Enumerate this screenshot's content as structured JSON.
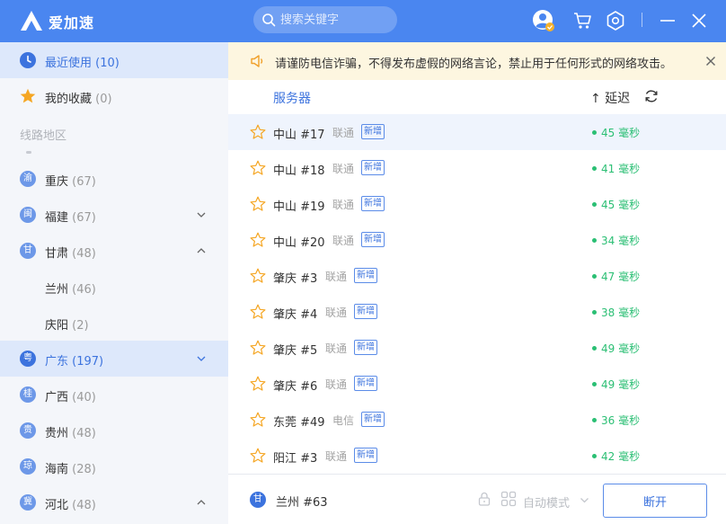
{
  "app": {
    "name": "爱加速"
  },
  "search": {
    "placeholder": "搜索关键字"
  },
  "sidebar": {
    "recent": {
      "label": "最近使用",
      "count": "(10)"
    },
    "favorites": {
      "label": "我的收藏",
      "count": "(0)"
    },
    "section_title": "线路地区",
    "regions": [
      {
        "badge": "渝",
        "name": "重庆",
        "count": "(67)"
      },
      {
        "badge": "闽",
        "name": "福建",
        "count": "(67)"
      },
      {
        "badge": "甘",
        "name": "甘肃",
        "count": "(48)"
      },
      {
        "name": "兰州",
        "count": "(46)"
      },
      {
        "name": "庆阳",
        "count": "(2)"
      },
      {
        "badge": "粤",
        "name": "广东",
        "count": "(197)"
      },
      {
        "badge": "桂",
        "name": "广西",
        "count": "(40)"
      },
      {
        "badge": "贵",
        "name": "贵州",
        "count": "(48)"
      },
      {
        "badge": "琼",
        "name": "海南",
        "count": "(28)"
      },
      {
        "badge": "冀",
        "name": "河北",
        "count": "(48)"
      }
    ]
  },
  "notice": {
    "text": "请谨防电信诈骗，不得发布虚假的网络言论，禁止用于任何形式的网络攻击。"
  },
  "list_header": {
    "server": "服务器",
    "latency": "↑ 延迟"
  },
  "servers": [
    {
      "name": "中山 #17",
      "isp": "联通",
      "tag": "新增",
      "latency": "45 毫秒"
    },
    {
      "name": "中山 #18",
      "isp": "联通",
      "tag": "新增",
      "latency": "41 毫秒"
    },
    {
      "name": "中山 #19",
      "isp": "联通",
      "tag": "新增",
      "latency": "45 毫秒"
    },
    {
      "name": "中山 #20",
      "isp": "联通",
      "tag": "新增",
      "latency": "34 毫秒"
    },
    {
      "name": "肇庆 #3",
      "isp": "联通",
      "tag": "新增",
      "latency": "47 毫秒"
    },
    {
      "name": "肇庆 #4",
      "isp": "联通",
      "tag": "新增",
      "latency": "38 毫秒"
    },
    {
      "name": "肇庆 #5",
      "isp": "联通",
      "tag": "新增",
      "latency": "49 毫秒"
    },
    {
      "name": "肇庆 #6",
      "isp": "联通",
      "tag": "新增",
      "latency": "49 毫秒"
    },
    {
      "name": "东莞 #49",
      "isp": "电信",
      "tag": "新增",
      "latency": "36 毫秒"
    },
    {
      "name": "阳江 #3",
      "isp": "联通",
      "tag": "新增",
      "latency": "42 毫秒"
    }
  ],
  "bottom": {
    "current_badge": "甘",
    "current_server": "兰州 #63",
    "mode_label": "自动模式",
    "disconnect_label": "断开"
  },
  "colors": {
    "primary": "#4a86f0",
    "accent": "#3c73de",
    "latency_green": "#2bbf74",
    "notice_bg": "#fdf6e0",
    "favorite_star": "#f5a623"
  }
}
